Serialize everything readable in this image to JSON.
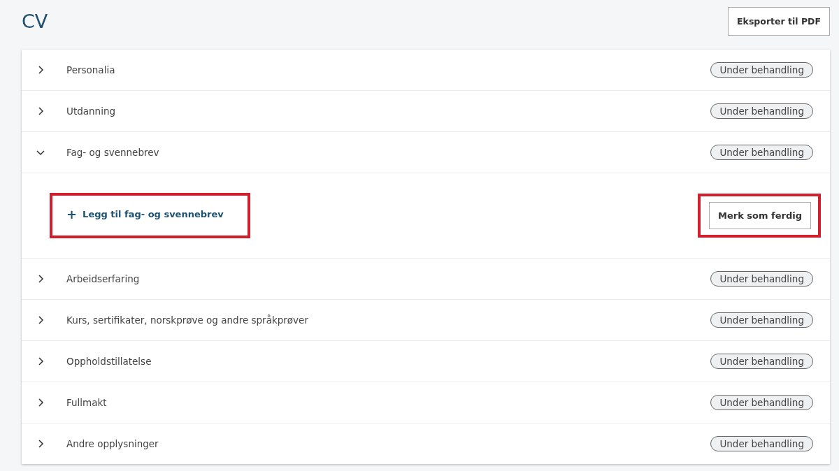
{
  "title": "CV",
  "export_button": "Eksporter til PDF",
  "sections": [
    {
      "label": "Personalia",
      "expanded": false,
      "status": "Under behandling"
    },
    {
      "label": "Utdanning",
      "expanded": false,
      "status": "Under behandling"
    },
    {
      "label": "Fag- og svennebrev",
      "expanded": true,
      "status": "Under behandling",
      "add_link": {
        "icon": "+",
        "label": "Legg til fag- og svennebrev",
        "highlighted": true
      },
      "done_button": {
        "label": "Merk som ferdig",
        "highlighted": true
      }
    },
    {
      "label": "Arbeidserfaring",
      "expanded": false,
      "status": "Under behandling"
    },
    {
      "label": "Kurs, sertifikater, norskprøve og andre språkprøver",
      "expanded": false,
      "status": "Under behandling"
    },
    {
      "label": "Oppholdstillatelse",
      "expanded": false,
      "status": "Under behandling"
    },
    {
      "label": "Fullmakt",
      "expanded": false,
      "status": "Under behandling"
    },
    {
      "label": "Andre opplysninger",
      "expanded": false,
      "status": "Under behandling"
    }
  ]
}
